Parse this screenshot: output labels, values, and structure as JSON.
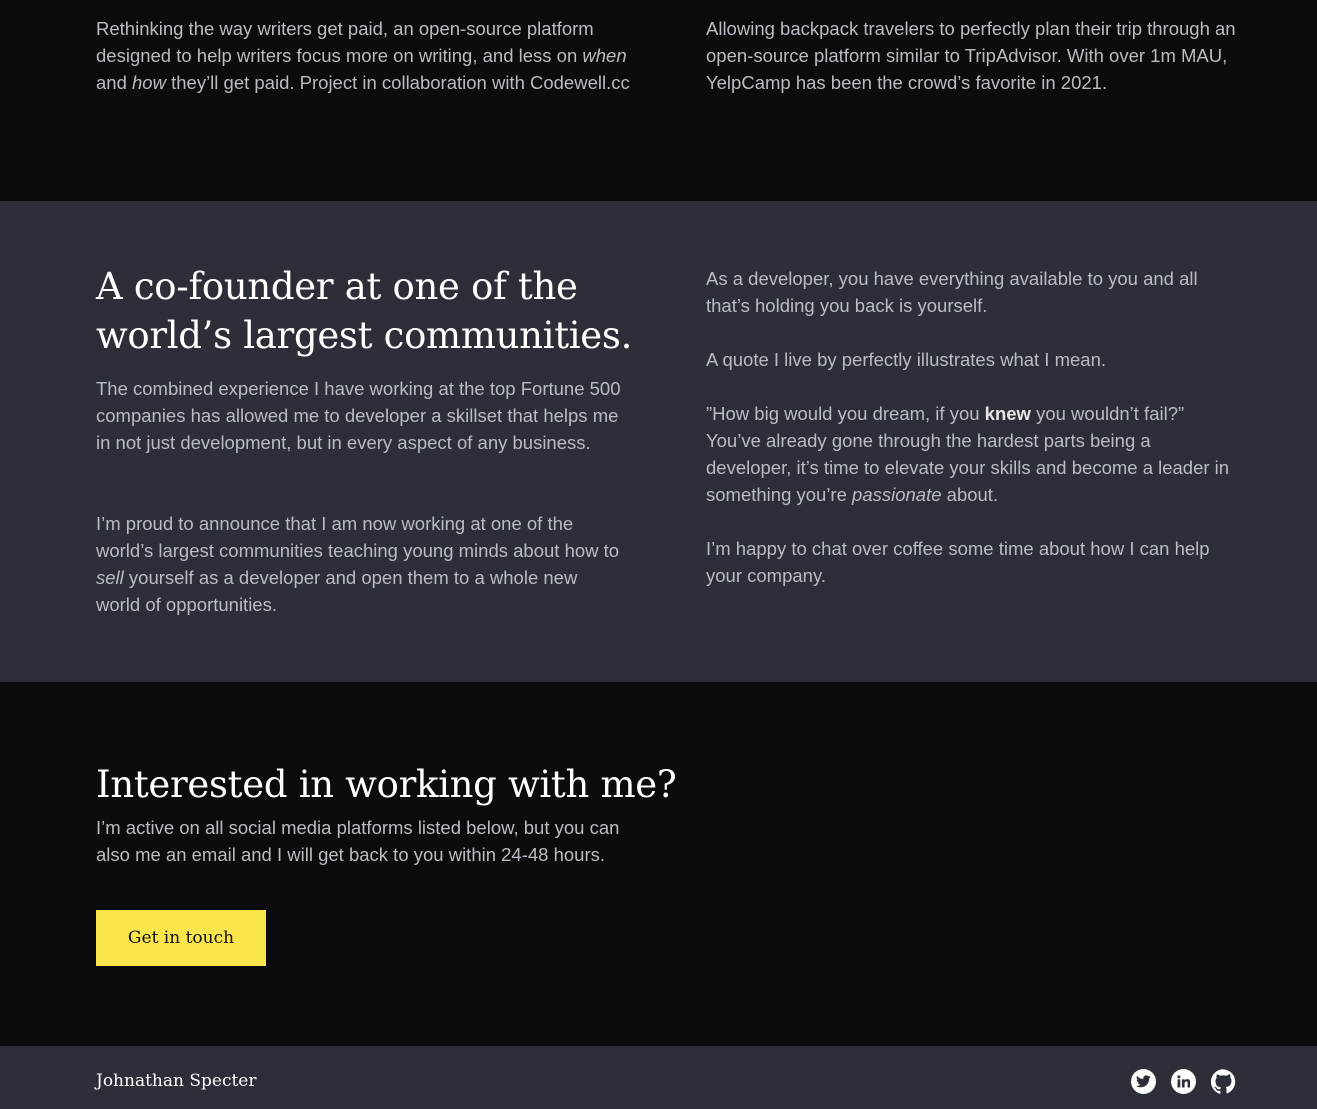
{
  "projects": [
    {
      "description_parts": [
        "Rethinking the way writers get paid, an open-source platform designed to help writers focus more on writing, and less on ",
        "when",
        " and ",
        "how",
        " they’ll get paid. Project in collaboration with Codewell.cc"
      ]
    },
    {
      "description": "Allowing backpack travelers to perfectly plan their trip through an open-source platform similar to TripAdvisor. With over 1m MAU, YelpCamp has been the crowd’s favorite in 2021."
    }
  ],
  "about": {
    "title": "A co-founder at one of the world’s largest communities.",
    "left_paragraph_1": "The combined experience I have working at the top Fortune 500 companies has allowed me to developer a skillset that helps me in not just development, but in every aspect of any business.",
    "left_paragraph_2_parts": [
      "I’m proud to announce that I am now working at one of the world’s largest communities teaching young minds about how to ",
      "sell",
      " yourself as a developer and open them to a whole new world of opportunities."
    ],
    "right_paragraph_1": "As a developer, you have everything available to you and all that’s holding you back is yourself.",
    "right_paragraph_2": "A quote I live by perfectly illustrates what I mean.",
    "right_paragraph_3_parts": [
      "”How big would you dream, if you ",
      "knew",
      " you wouldn’t fail?” You’ve already gone through the hardest parts being a developer, it’s time to elevate your skills and become a leader in something you’re ",
      "passionate",
      " about."
    ],
    "right_paragraph_4": "I’m happy to chat over coffee some time about how I can help your company."
  },
  "contact": {
    "title": "Interested in working with me?",
    "description": "I’m active on all social media platforms listed below, but you can also me an email and I will get back to you within 24-48 hours.",
    "button_label": "Get in touch"
  },
  "footer": {
    "name": "Johnathan Specter",
    "social_icons": [
      "twitter-icon",
      "linkedin-icon",
      "github-icon"
    ]
  },
  "colors": {
    "background_dark": "#0c0c0f",
    "background_panel": "#2c2f37",
    "accent_yellow": "#fbe54d",
    "body_text": "#b9bcc3",
    "heading_text": "#ffffff"
  }
}
